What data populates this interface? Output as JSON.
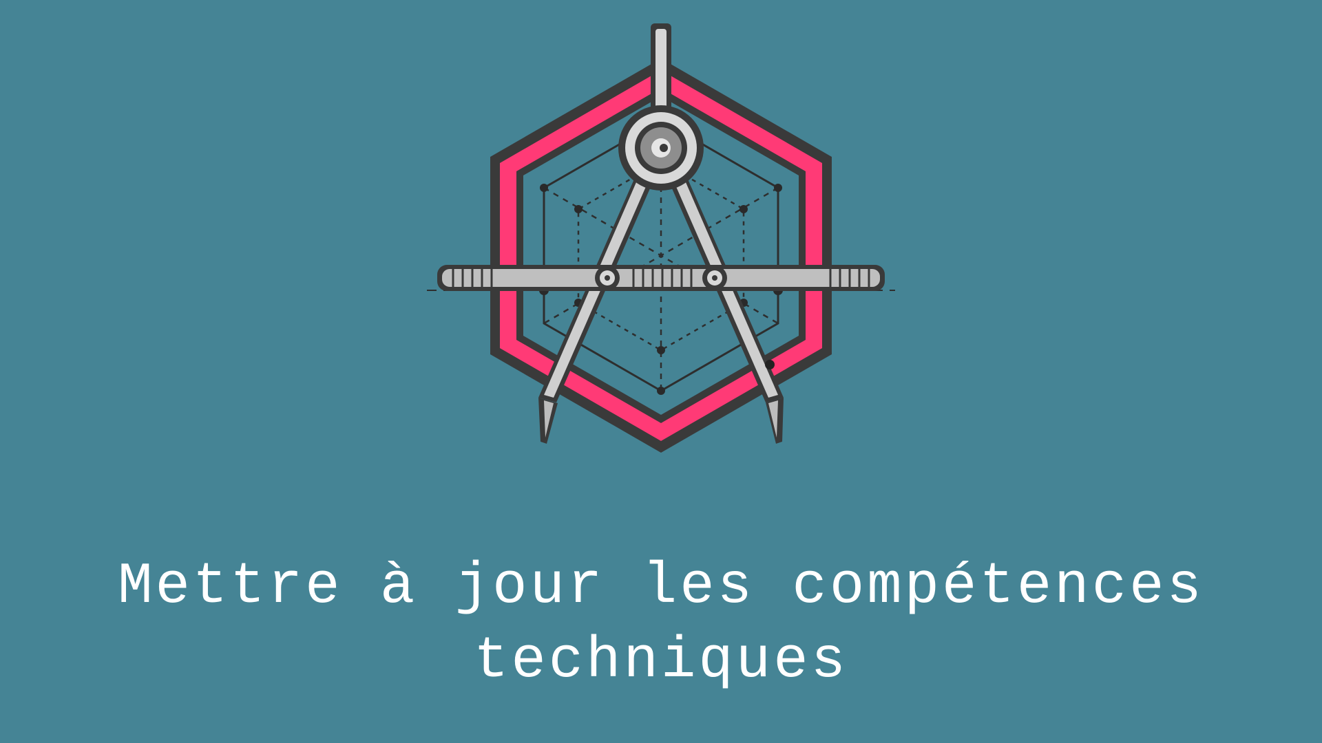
{
  "slide": {
    "background_color": "#458495",
    "accent_color": "#ff3a76",
    "outline_color": "#3a3a3a",
    "emblem_icon": "drafting-compass-in-hexagon-icon",
    "caption": "Mettre à jour les compétences\ntechniques"
  }
}
